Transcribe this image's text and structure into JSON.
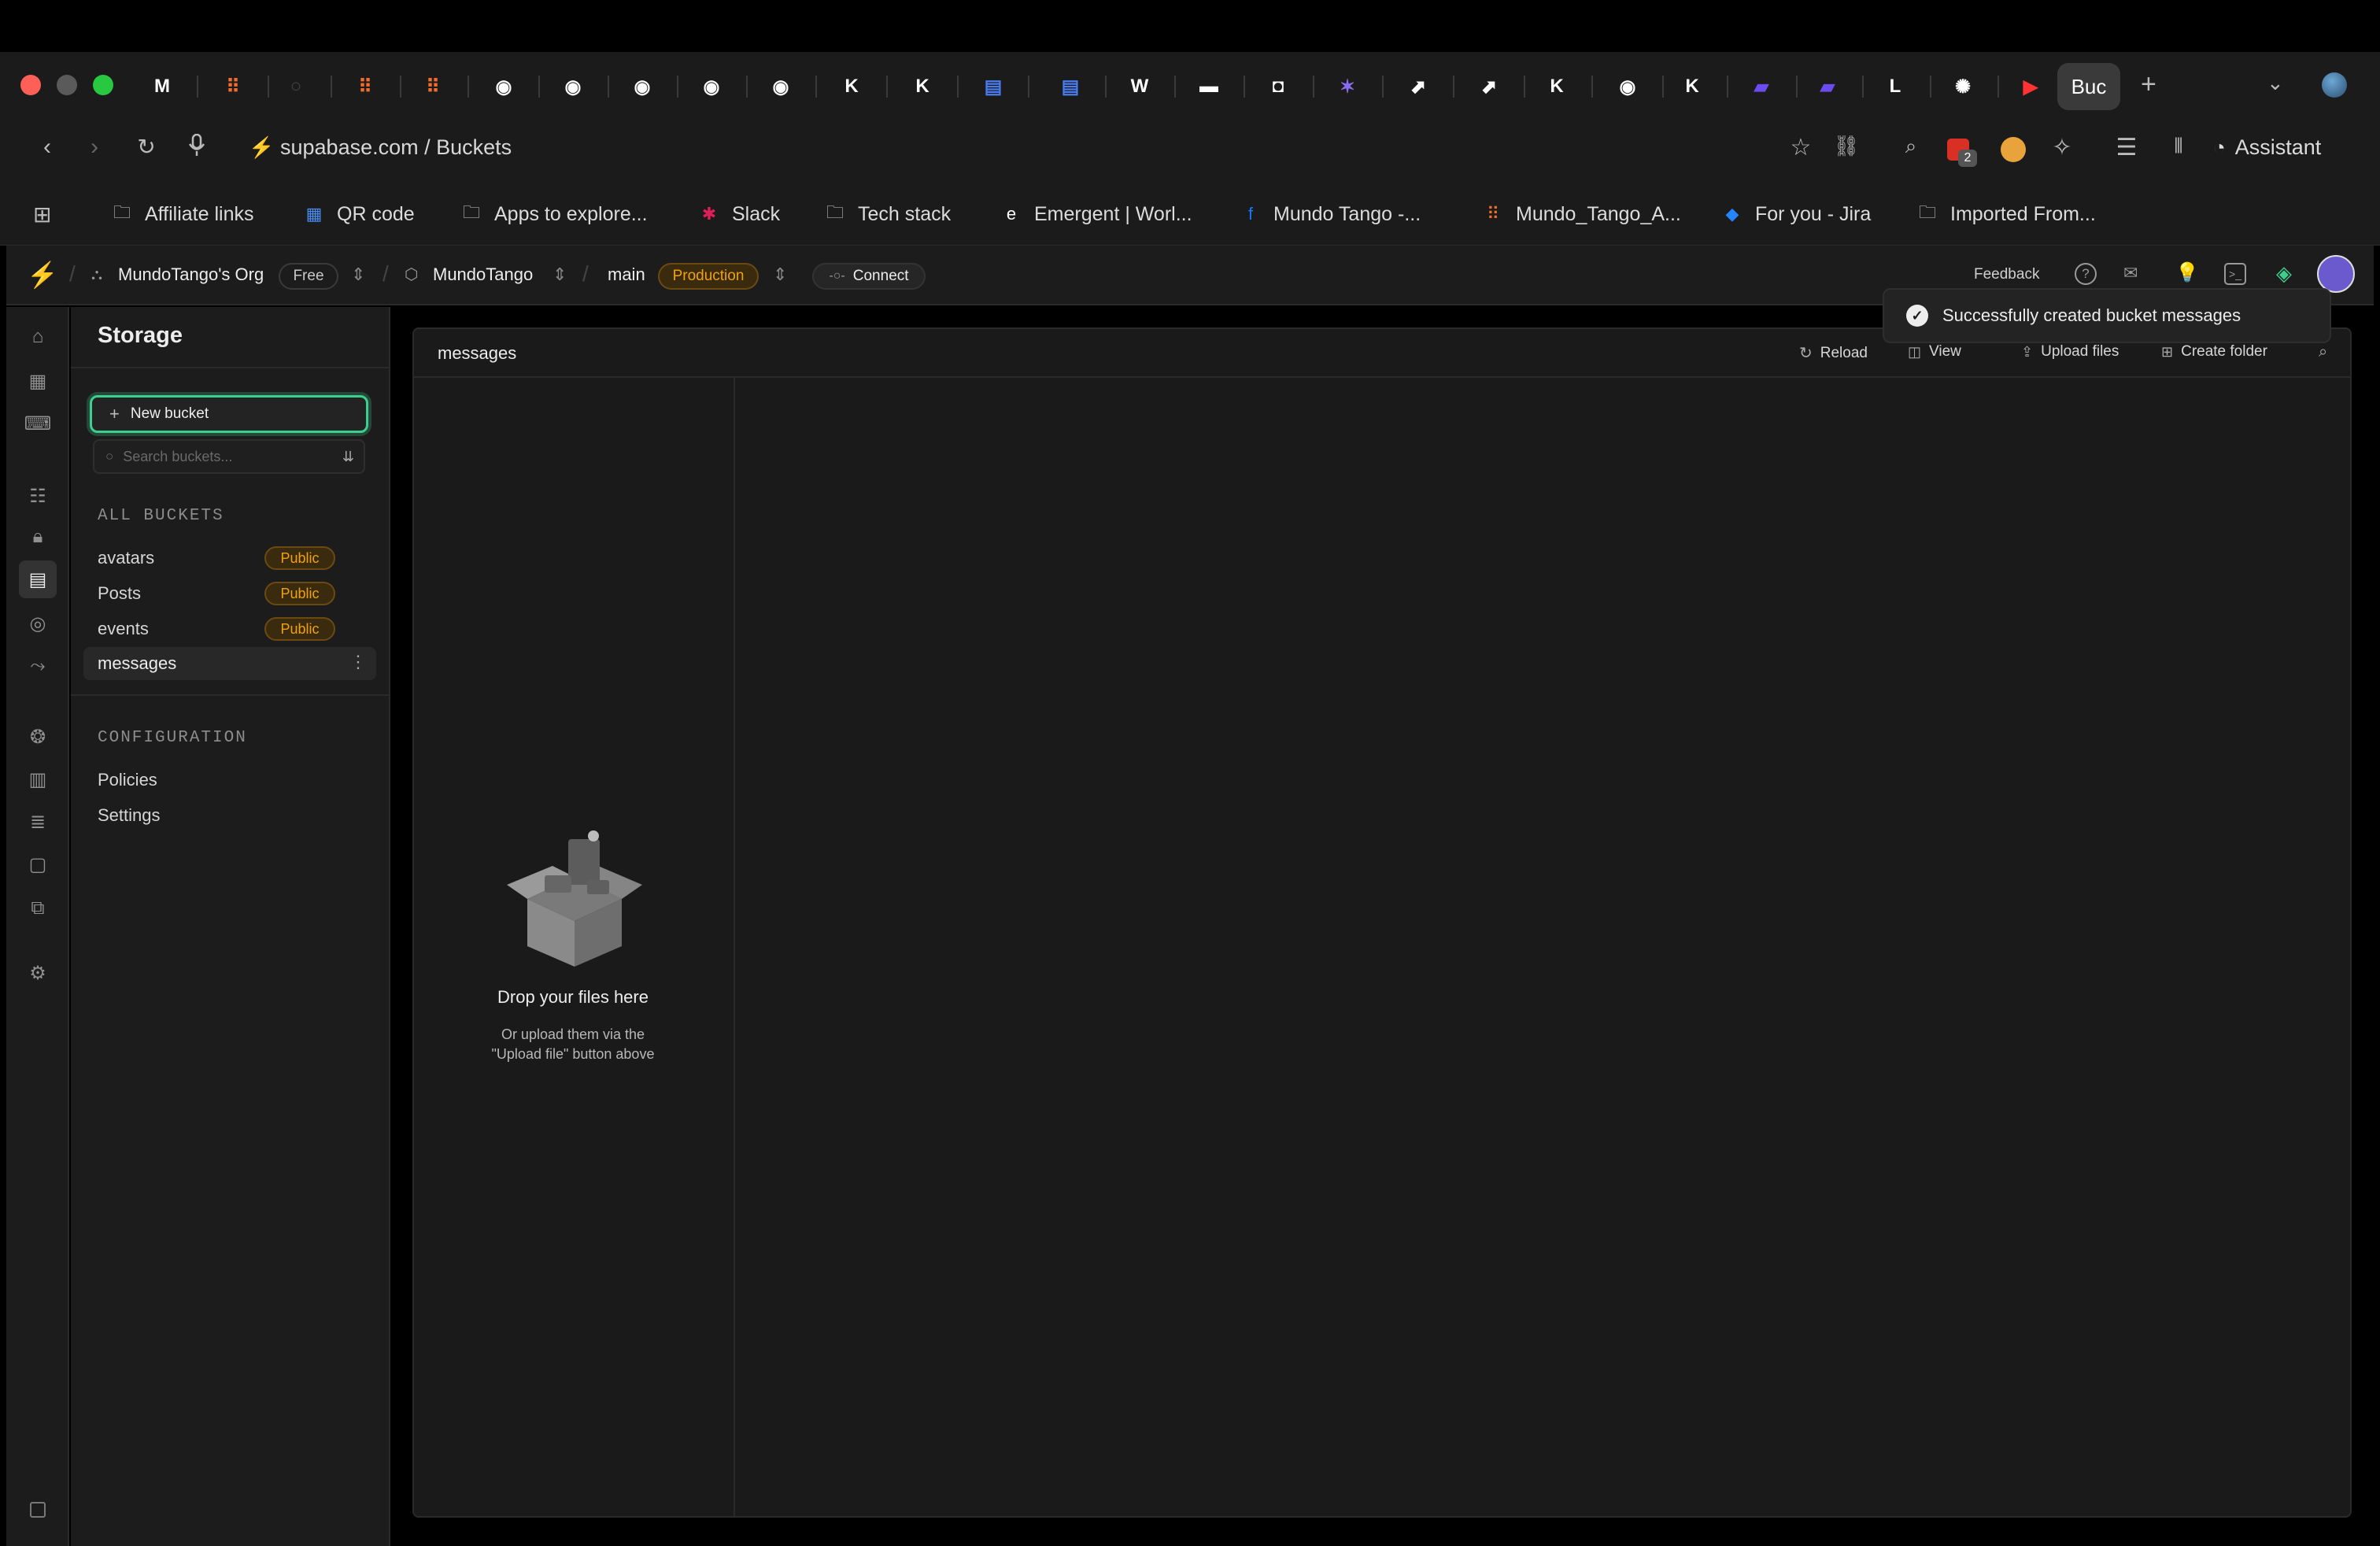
{
  "browser": {
    "active_tab_label": "Buc",
    "new_tab_icon": "plus-icon",
    "url_text": "supabase.com / Buckets",
    "extension_badge_count": "2",
    "assistant_label": "Assistant"
  },
  "bookmarks": [
    {
      "label": "Affiliate links",
      "icon": "folder-icon"
    },
    {
      "label": "QR code",
      "icon": "qr-app-icon"
    },
    {
      "label": "Apps to explore...",
      "icon": "folder-icon"
    },
    {
      "label": "Slack",
      "icon": "slack-icon"
    },
    {
      "label": "Tech stack",
      "icon": "folder-icon"
    },
    {
      "label": "Emergent | Worl...",
      "icon": "emergent-icon"
    },
    {
      "label": "Mundo Tango -...",
      "icon": "facebook-icon"
    },
    {
      "label": "Mundo_Tango_A...",
      "icon": "replit-icon"
    },
    {
      "label": "For you - Jira",
      "icon": "jira-icon"
    },
    {
      "label": "Imported From...",
      "icon": "folder-icon"
    }
  ],
  "project_bar": {
    "org_name": "MundoTango's Org",
    "org_plan": "Free",
    "project_name": "MundoTango",
    "branch": "main",
    "branch_badge": "Production",
    "connect_label": "Connect",
    "feedback_label": "Feedback"
  },
  "sidebar": {
    "title": "Storage",
    "new_bucket_label": "New bucket",
    "search_placeholder": "Search buckets...",
    "all_buckets_label": "ALL BUCKETS",
    "buckets": [
      {
        "name": "avatars",
        "badge": "Public"
      },
      {
        "name": "Posts",
        "badge": "Public"
      },
      {
        "name": "events",
        "badge": "Public"
      },
      {
        "name": "messages",
        "badge": ""
      }
    ],
    "configuration_label": "CONFIGURATION",
    "config_items": [
      "Policies",
      "Settings"
    ]
  },
  "main": {
    "bucket_title": "messages",
    "actions": {
      "reload": "Reload",
      "view": "View",
      "upload": "Upload files",
      "create_folder": "Create folder"
    },
    "drop_title": "Drop your files here",
    "drop_sub_1": "Or upload them via the",
    "drop_sub_2": "\"Upload file\" button above"
  },
  "toast": {
    "message": "Successfully created bucket messages"
  },
  "colors": {
    "brand": "#3ecf8e",
    "badge_amber": "#f1a10d",
    "background": "#1c1c1c"
  }
}
